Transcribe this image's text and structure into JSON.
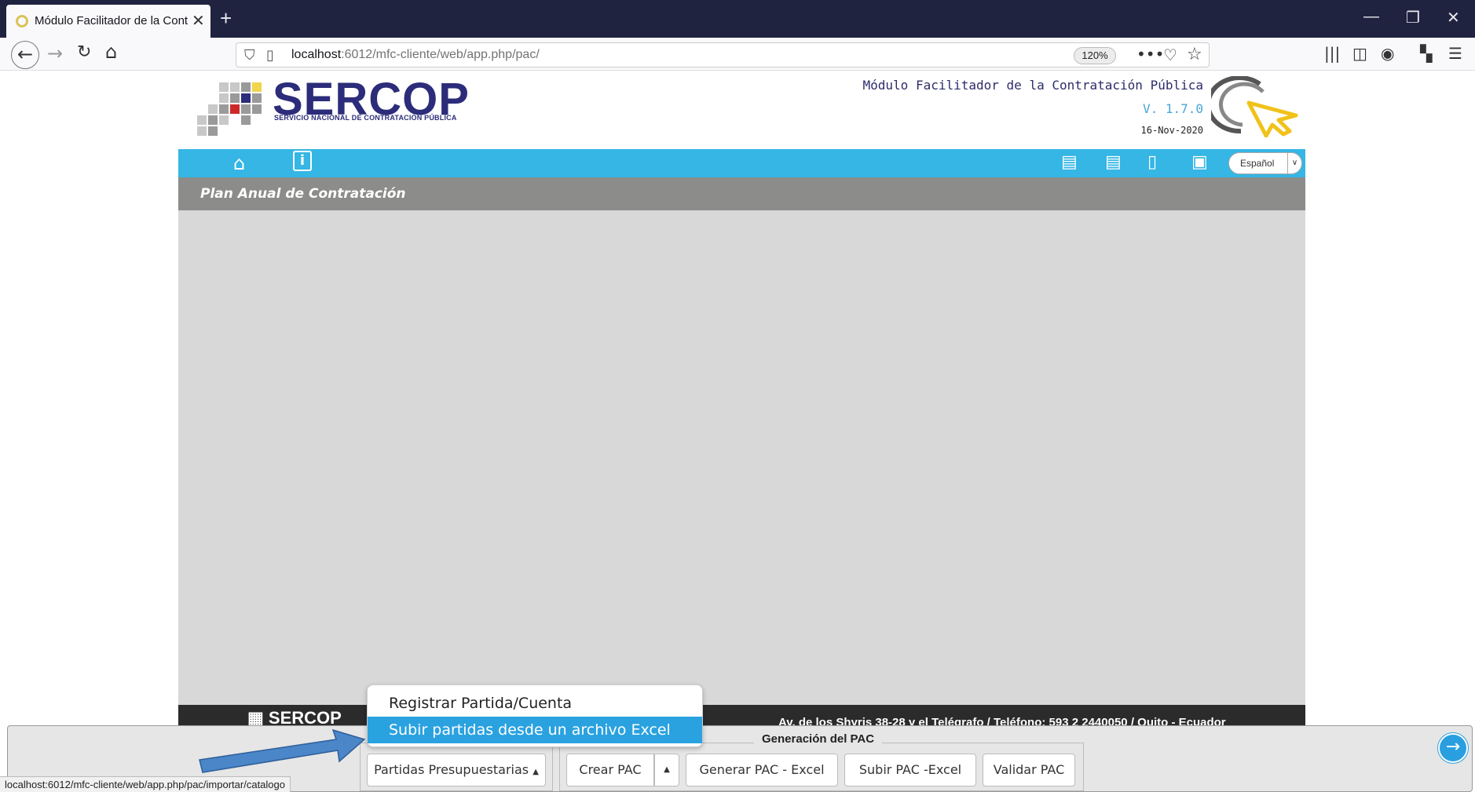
{
  "browser": {
    "tab_title": "Módulo Facilitador de la Contra",
    "url_host": "localhost",
    "url_rest": ":6012/mfc-cliente/web/app.php/pac/",
    "zoom": "120%",
    "status_url": "localhost:6012/mfc-cliente/web/app.php/pac/importar/catalogo"
  },
  "header": {
    "brand": "SERCOP",
    "brand_subtitle": "SERVICIO NACIONAL DE CONTRATACIÓN PÚBLICA",
    "module_name": "Módulo Facilitador de la Contratación Pública",
    "version": "V. 1.7.0",
    "date": "16-Nov-2020"
  },
  "toolbar": {
    "language": "Español"
  },
  "page": {
    "title": "Plan Anual de Contratación"
  },
  "footer": {
    "logo": "SERCOP",
    "address": "Av. de los Shyris 38-28 y el Telégrafo / Teléfono: 593 2 2440050 / Quito - Ecuador"
  },
  "dropdown": {
    "items": [
      "Registrar Partida/Cuenta",
      "Subir partidas desde un archivo Excel"
    ],
    "selected_index": 1
  },
  "actions": {
    "group_label": "Generación del PAC",
    "partidas": "Partidas Presupuestarias",
    "crear": "Crear PAC",
    "generar": "Generar PAC - Excel",
    "subir": "Subir PAC -Excel",
    "validar": "Validar PAC"
  },
  "colors": {
    "toolbar_blue": "#35b6e4",
    "title_gray": "#8c8c8a",
    "brand_navy": "#2c2c7a",
    "menu_highlight": "#2aa2e0",
    "annotation_arrow": "#4a86c8"
  }
}
